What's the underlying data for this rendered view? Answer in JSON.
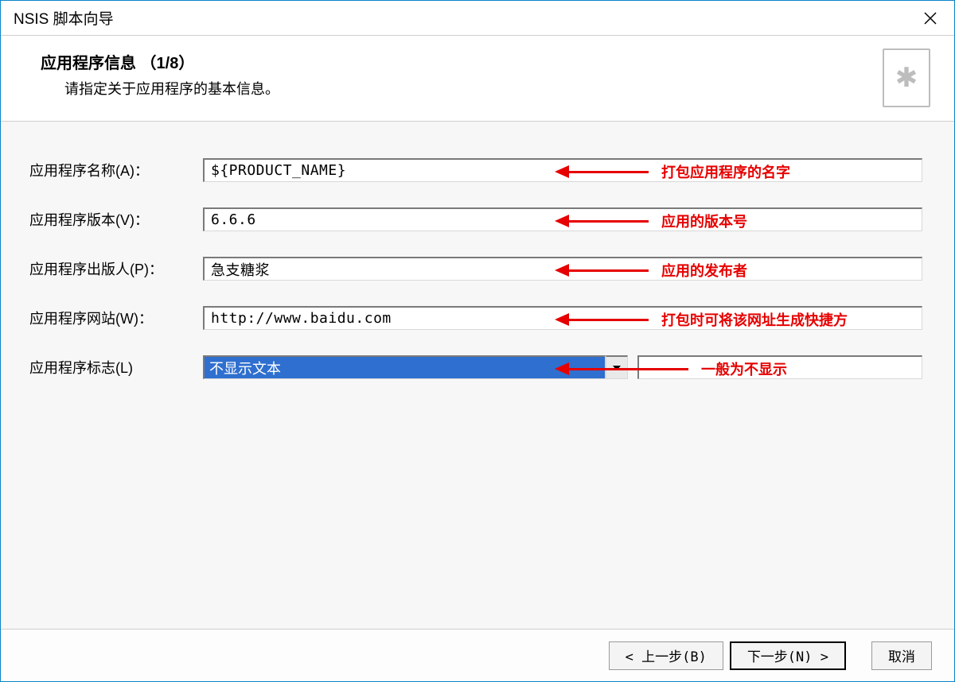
{
  "window": {
    "title": "NSIS 脚本向导"
  },
  "header": {
    "title": "应用程序信息 （1/8）",
    "subtitle": "请指定关于应用程序的基本信息。"
  },
  "form": {
    "name": {
      "label": "应用程序名称(A)：",
      "value": "${PRODUCT_NAME}",
      "annotation": "打包应用程序的名字"
    },
    "version": {
      "label": "应用程序版本(V)：",
      "value": "6.6.6",
      "annotation": "应用的版本号"
    },
    "publisher": {
      "label": "应用程序出版人(P)：",
      "value": "急支糖浆",
      "annotation": "应用的发布者"
    },
    "website": {
      "label": "应用程序网站(W)：",
      "value": "http://www.baidu.com",
      "annotation": "打包时可将该网址生成快捷方"
    },
    "logo": {
      "label": "应用程序标志(L)",
      "value": "不显示文本",
      "annotation": "一般为不显示"
    }
  },
  "footer": {
    "back": "< 上一步(B)",
    "next": "下一步(N) >",
    "cancel": "取消"
  }
}
